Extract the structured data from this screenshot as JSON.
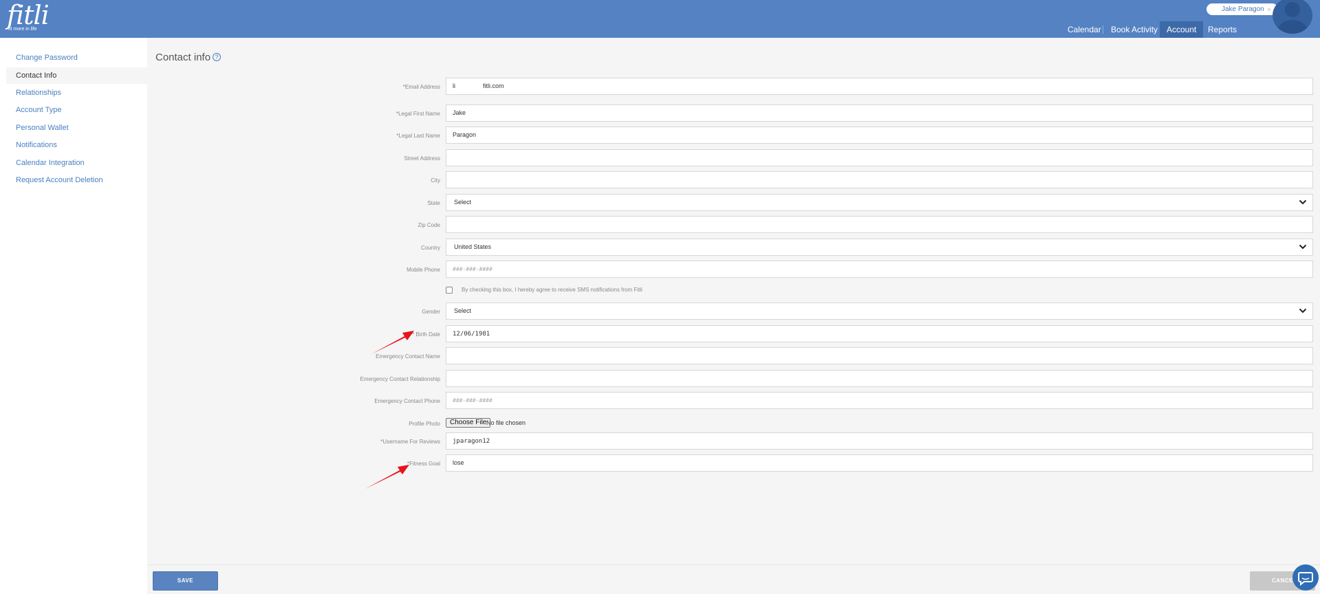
{
  "brand": {
    "logo_text": "fitli",
    "tagline": "fit more in life"
  },
  "user": {
    "name": "Jake Paragon",
    "menu_icon": "double-chevron-down-icon"
  },
  "nav": {
    "items": [
      {
        "label": "Calendar"
      },
      {
        "label": "Book Activity"
      },
      {
        "label": "Account",
        "active": true
      },
      {
        "label": "Reports"
      }
    ]
  },
  "sidebar": {
    "items": [
      {
        "label": "Change Password"
      },
      {
        "label": "Contact Info",
        "active": true
      },
      {
        "label": "Relationships"
      },
      {
        "label": "Account Type"
      },
      {
        "label": "Personal Wallet"
      },
      {
        "label": "Notifications"
      },
      {
        "label": "Calendar Integration"
      },
      {
        "label": "Request Account Deletion"
      }
    ]
  },
  "page": {
    "title": "Contact info",
    "help_glyph": "?"
  },
  "form": {
    "email": {
      "label": "*Email Address",
      "value": "li                fitli.com"
    },
    "first_name": {
      "label": "*Legal First Name",
      "value": "Jake"
    },
    "last_name": {
      "label": "*Legal Last Name",
      "value": "Paragon"
    },
    "street": {
      "label": "Street Address",
      "value": ""
    },
    "city": {
      "label": "City",
      "value": ""
    },
    "state": {
      "label": "State",
      "value": "Select"
    },
    "zip": {
      "label": "Zip Code",
      "value": ""
    },
    "country": {
      "label": "Country",
      "value": "United States"
    },
    "mobile": {
      "label": "Mobile Phone",
      "placeholder": "###-###-####"
    },
    "sms_consent": {
      "label": "By checking this box, I hereby agree to receive SMS notifications from Fitli",
      "checked": false
    },
    "gender": {
      "label": "Gender",
      "value": "Select"
    },
    "birth_date": {
      "label": "* Birth Date",
      "value": "12/06/1981"
    },
    "emergency_name": {
      "label": "Emergency Contact Name",
      "value": ""
    },
    "emergency_relationship": {
      "label": "Emergency Contact Relationship",
      "value": ""
    },
    "emergency_phone": {
      "label": "Emergency Contact Phone",
      "placeholder": "###-###-####"
    },
    "profile_photo": {
      "label": "Profile Photo",
      "button": "Choose File",
      "status": "No file chosen"
    },
    "username": {
      "label": "*Username For Reviews",
      "value": "jparagon12"
    },
    "fitness_goal": {
      "label": "*Fitness Goal",
      "value": "lose"
    }
  },
  "actions": {
    "save": "SAVE",
    "cancel": "CANCEL"
  },
  "colors": {
    "header": "#5482c3",
    "accent": "#4a7fc0",
    "annotation_arrow": "#e8141b"
  }
}
